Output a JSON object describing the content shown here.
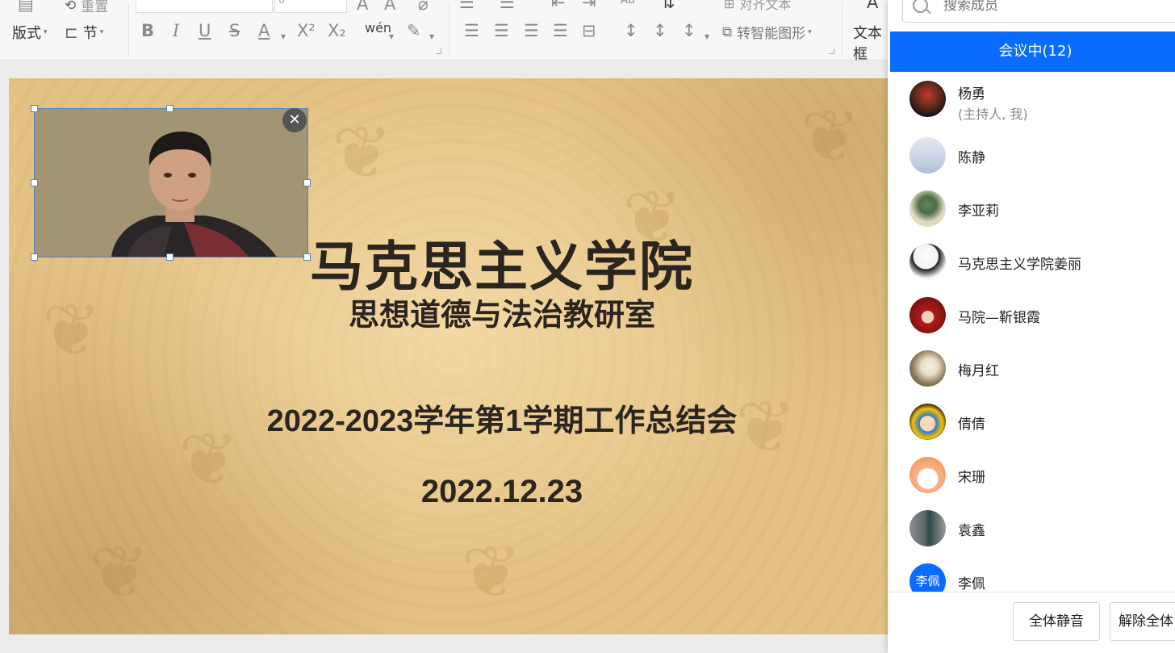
{
  "ribbon": {
    "layout_label": "版式",
    "reset_label": "重置",
    "section_label": "节",
    "font_size_value": "0",
    "pinyin_label": "wén",
    "align_text_label": "对齐文本",
    "smart_shape_label": "转智能图形",
    "textbox_label": "文本框",
    "icons": [
      "bold-icon",
      "italic-icon",
      "underline-icon",
      "strikethrough-icon",
      "font-color-icon",
      "superscript-icon",
      "subscript-icon",
      "pinyin-icon",
      "highlight-icon",
      "align-left-icon",
      "align-center-icon",
      "align-right-icon",
      "justify-icon",
      "distribute-icon",
      "line-spacing-icon",
      "paragraph-spacing-icon",
      "smart-shape-icon"
    ]
  },
  "slide": {
    "title": "马克思主义学院",
    "subtitle": "思想道德与法治教研室",
    "meeting_name": "2022-2023学年第1学期工作总结会",
    "date": "2022.12.23"
  },
  "video": {
    "close_symbol": "✕"
  },
  "panel": {
    "search_placeholder": "搜索成员",
    "tab_label": "会议中(12)",
    "members": [
      {
        "name": "杨勇",
        "note": "(主持人, 我)",
        "avatar": "photo",
        "color": "#2b2b2b"
      },
      {
        "name": "陈静",
        "avatar": "photo",
        "color": "#cfd6e8"
      },
      {
        "name": "李亚莉",
        "avatar": "photo",
        "color": "#d8cdb0"
      },
      {
        "name": "马克思主义学院姜丽",
        "avatar": "photo",
        "color": "#f3f3f3"
      },
      {
        "name": "马院—靳银霞",
        "avatar": "photo",
        "color": "#b31b1b"
      },
      {
        "name": "梅月红",
        "avatar": "photo",
        "color": "#8e7a58"
      },
      {
        "name": "倩倩",
        "avatar": "photo",
        "color": "#1c2230"
      },
      {
        "name": "宋珊",
        "avatar": "photo",
        "color": "#f39a5a"
      },
      {
        "name": "袁鑫",
        "avatar": "photo",
        "color": "#6b6b6b"
      },
      {
        "name": "李佩",
        "avatar": "text",
        "avatar_text": "李佩",
        "color": "#0a6cff"
      }
    ],
    "mute_all_label": "全体静音",
    "unmute_all_label": "解除全体"
  },
  "colors": {
    "accent": "#0a6cff",
    "slide_bg": "#e4c284"
  }
}
